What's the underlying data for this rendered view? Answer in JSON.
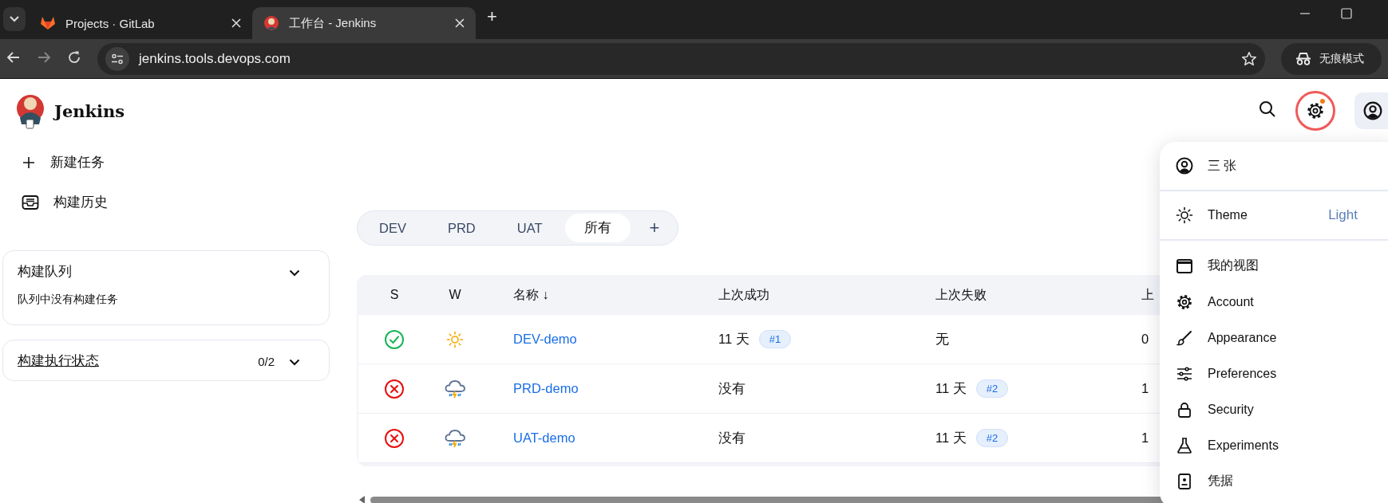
{
  "browser": {
    "tabs": [
      {
        "title": "Projects · GitLab",
        "selected": false
      },
      {
        "title": "工作台 - Jenkins",
        "selected": true
      }
    ],
    "new_tab": "+",
    "url": "jenkins.tools.devops.com",
    "incognito": "无痕模式"
  },
  "header": {
    "brand": "Jenkins",
    "settings_notification": true,
    "settings_circled": true
  },
  "sidebar": {
    "actions": [
      {
        "label": "新建任务"
      },
      {
        "label": "构建历史"
      }
    ],
    "queue": {
      "title": "构建队列",
      "message": "队列中没有构建任务"
    },
    "executors": {
      "title": "构建执行状态",
      "count": "0/2"
    }
  },
  "views": {
    "tabs": [
      {
        "label": "DEV",
        "selected": false
      },
      {
        "label": "PRD",
        "selected": false
      },
      {
        "label": "UAT",
        "selected": false
      },
      {
        "label": "所有",
        "selected": true
      }
    ],
    "add": "+"
  },
  "jobs": {
    "columns": [
      "S",
      "W",
      "名称 ↓",
      "上次成功",
      "上次失败",
      "上"
    ],
    "rows": [
      {
        "passed": true,
        "name": "DEV-demo",
        "last_success": {
          "time": "11 天",
          "build": "#1"
        },
        "last_failure": {
          "time": "无"
        },
        "column_6": "0"
      },
      {
        "passed": false,
        "name": "PRD-demo",
        "last_success": {
          "time": "没有"
        },
        "last_failure": {
          "time": "11 天",
          "build": "#2"
        },
        "column_6": "1"
      },
      {
        "passed": false,
        "name": "UAT-demo",
        "last_success": {
          "time": "没有"
        },
        "last_failure": {
          "time": "11 天",
          "build": "#2"
        },
        "column_6": "1"
      }
    ]
  },
  "user_menu": {
    "user": "三 张",
    "theme": {
      "label": "Theme",
      "value": "Light"
    },
    "items": [
      {
        "label": "我的视图"
      },
      {
        "label": "Account"
      },
      {
        "label": "Appearance"
      },
      {
        "label": "Preferences"
      },
      {
        "label": "Security"
      },
      {
        "label": "Experiments"
      },
      {
        "label": "凭据"
      }
    ]
  }
}
